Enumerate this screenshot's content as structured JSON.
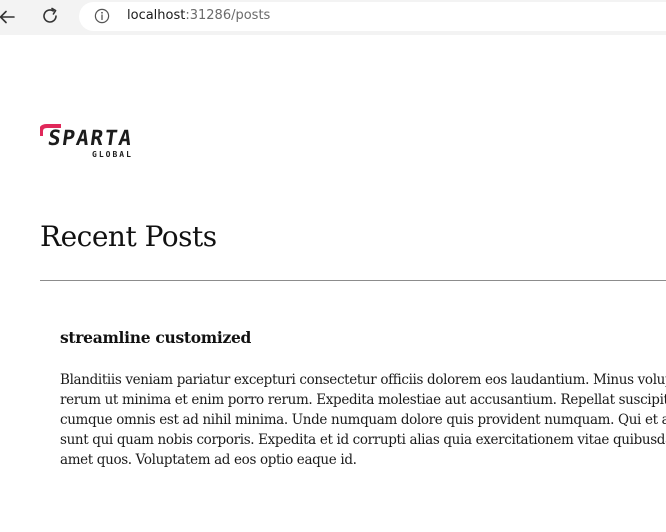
{
  "browser": {
    "url_host": "localhost",
    "url_rest": ":31286/posts"
  },
  "logo": {
    "wordmark": "SPARTA",
    "subtitle": "GLOBAL",
    "accent_color": "#e0285a"
  },
  "page": {
    "title": "Recent Posts"
  },
  "posts": [
    {
      "title": "streamline customized",
      "body_lines": [
        "Blanditiis veniam pariatur excepturi consectetur officiis dolorem eos laudantium. Minus volupta",
        "rerum ut minima et enim porro rerum. Expedita molestiae aut accusantium. Repellat suscipit par",
        "cumque omnis est ad nihil minima. Unde numquam dolore quis provident numquam. Qui et anim",
        "sunt qui quam nobis corporis. Expedita et id corrupti alias quia exercitationem vitae quibusdam a",
        "amet quos. Voluptatem ad eos optio eaque id."
      ]
    }
  ]
}
